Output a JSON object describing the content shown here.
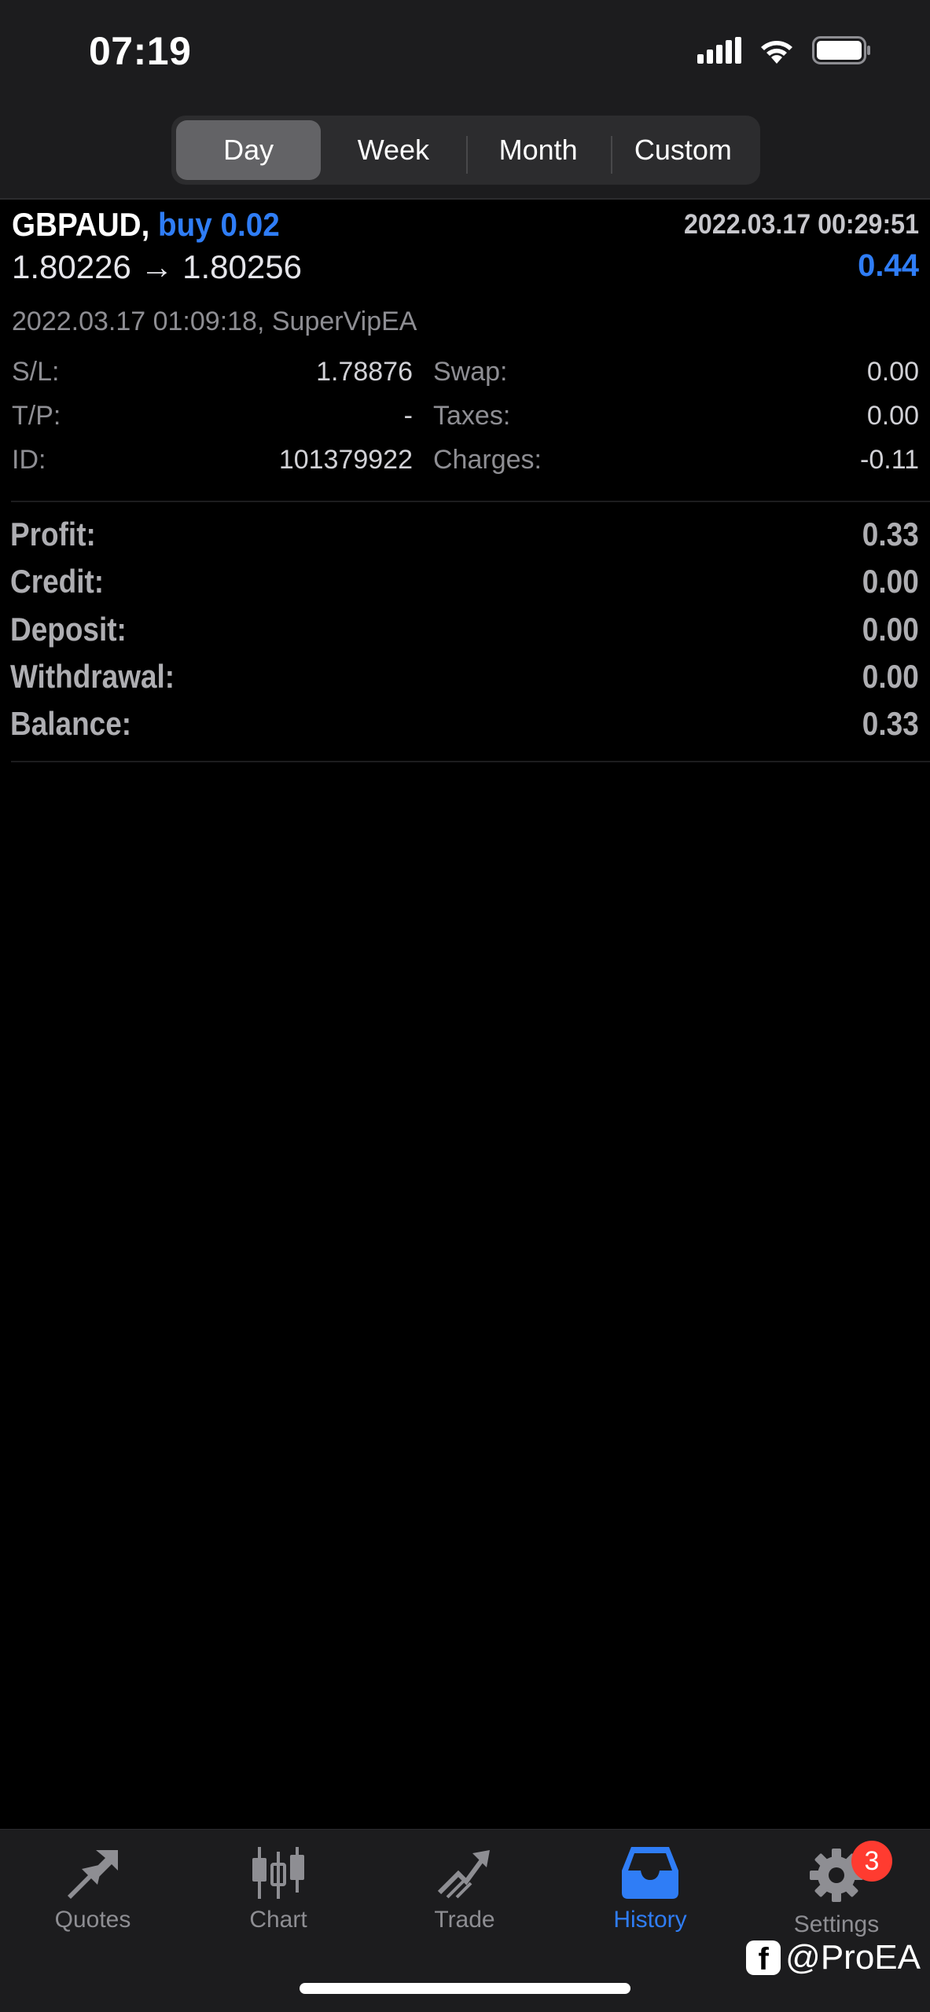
{
  "status_bar": {
    "time": "07:19"
  },
  "period_tabs": [
    {
      "label": "Day",
      "active": true
    },
    {
      "label": "Week",
      "active": false
    },
    {
      "label": "Month",
      "active": false
    },
    {
      "label": "Custom",
      "active": false
    }
  ],
  "deal": {
    "symbol": "GBPAUD,",
    "side": "buy 0.02",
    "open_time": "2022.03.17 00:29:51",
    "prices": "1.80226 → 1.80256",
    "profit": "0.44",
    "close_info": "2022.03.17 01:09:18, SuperVipEA",
    "details_left": [
      {
        "label": "S/L:",
        "value": "1.78876"
      },
      {
        "label": "T/P:",
        "value": "-"
      },
      {
        "label": "ID:",
        "value": "101379922"
      }
    ],
    "details_right": [
      {
        "label": "Swap:",
        "value": "0.00"
      },
      {
        "label": "Taxes:",
        "value": "0.00"
      },
      {
        "label": "Charges:",
        "value": "-0.11"
      }
    ]
  },
  "summary": [
    {
      "label": "Profit:",
      "value": "0.33"
    },
    {
      "label": "Credit:",
      "value": "0.00"
    },
    {
      "label": "Deposit:",
      "value": "0.00"
    },
    {
      "label": "Withdrawal:",
      "value": "0.00"
    },
    {
      "label": "Balance:",
      "value": "0.33"
    }
  ],
  "tabbar": [
    {
      "label": "Quotes",
      "icon": "quotes-icon",
      "active": false
    },
    {
      "label": "Chart",
      "icon": "chart-icon",
      "active": false
    },
    {
      "label": "Trade",
      "icon": "trade-icon",
      "active": false
    },
    {
      "label": "History",
      "icon": "history-icon",
      "active": true
    },
    {
      "label": "Settings",
      "icon": "settings-icon",
      "active": false,
      "badge": "3"
    }
  ],
  "watermark": "@ProEA",
  "colors": {
    "accent": "#2f7df6",
    "badge": "#ff3b30",
    "background": "#000000",
    "bar": "#1c1c1e"
  }
}
